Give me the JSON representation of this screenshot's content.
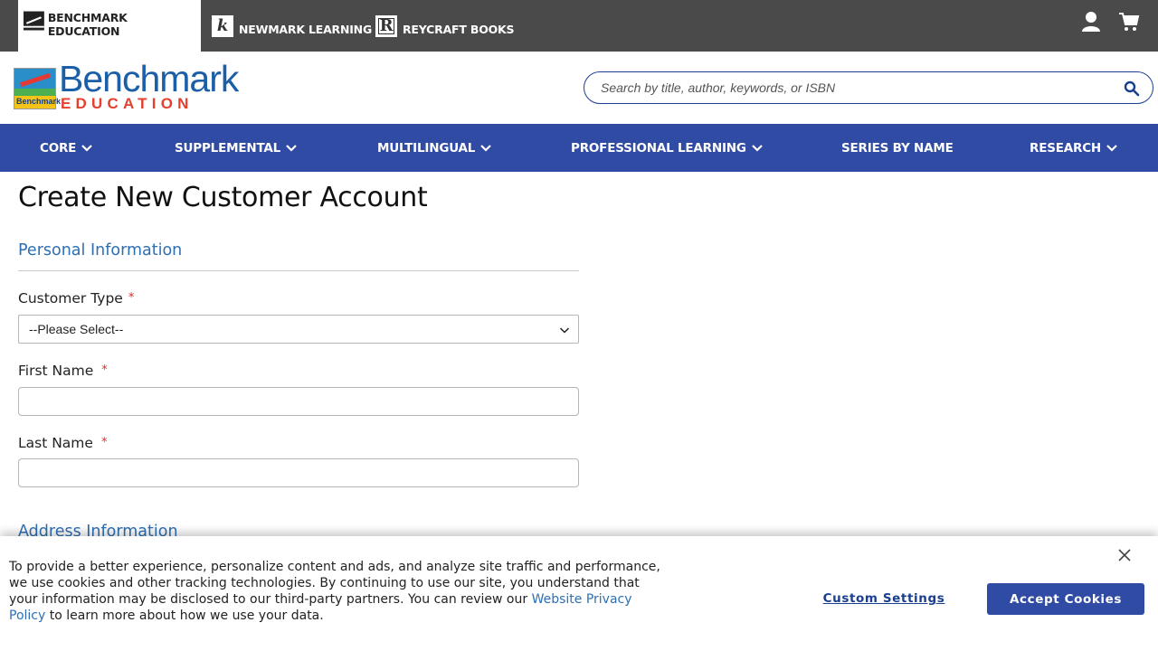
{
  "brands": [
    {
      "label": "BENCHMARK EDUCATION",
      "active": true
    },
    {
      "label": "NEWMARK LEARNING",
      "logo_text": "k"
    },
    {
      "label": "REYCRAFT BOOKS",
      "logo_text": "R"
    }
  ],
  "header_icons": [
    "user-icon",
    "cart-icon"
  ],
  "logo": {
    "line1": "Benchmark",
    "line2": "EDUCATION",
    "mark_text": "Benchmark"
  },
  "search": {
    "placeholder": "Search by title, author, keywords, or ISBN",
    "icon": "search-icon"
  },
  "nav": [
    {
      "label": "CORE",
      "has_dropdown": true
    },
    {
      "label": "SUPPLEMENTAL",
      "has_dropdown": true
    },
    {
      "label": "MULTILINGUAL",
      "has_dropdown": true
    },
    {
      "label": "PROFESSIONAL LEARNING",
      "has_dropdown": true
    },
    {
      "label": "SERIES BY NAME",
      "has_dropdown": false
    },
    {
      "label": "RESEARCH",
      "has_dropdown": true
    }
  ],
  "page": {
    "title": "Create New Customer Account",
    "personal_section": "Personal Information",
    "address_section": "Address Information",
    "required_marker": "*",
    "customer_type": {
      "label": "Customer Type",
      "value": "--Please Select--"
    },
    "first_name": {
      "label": "First Name",
      "value": ""
    },
    "last_name": {
      "label": "Last Name",
      "value": ""
    }
  },
  "cookie": {
    "text_before_link": "To provide a better experience, personalize content and ads, and analyze site traffic and performance, we use cookies and other tracking technologies. By continuing to use our site, you understand that your information may be disclosed to our third-party partners. You can review our ",
    "link_text": "Website Privacy Policy",
    "text_after_link": " to learn more about how we use your data.",
    "settings_label": "Custom Settings",
    "accept_label": "Accept Cookies"
  },
  "colors": {
    "nav_bg": "#2f4ba3",
    "topbar_bg": "#4a4a4a",
    "link": "#2d6fb5",
    "required": "#e02b27"
  }
}
